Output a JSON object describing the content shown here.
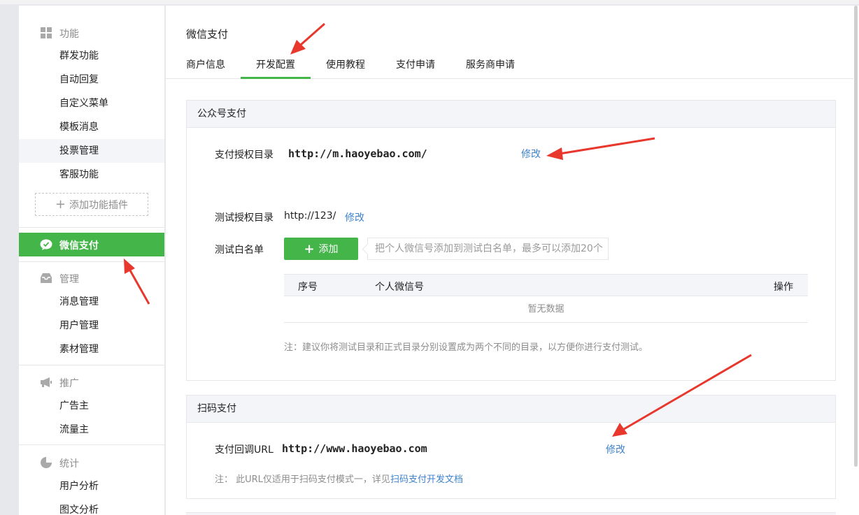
{
  "sidebar": {
    "sections": [
      {
        "heading": "功能",
        "icon": "grid-icon",
        "items": [
          "群发功能",
          "自动回复",
          "自定义菜单",
          "模板消息",
          "投票管理",
          "客服功能"
        ]
      },
      {
        "heading": "管理",
        "icon": "inbox-icon",
        "items": [
          "消息管理",
          "用户管理",
          "素材管理"
        ]
      },
      {
        "heading": "推广",
        "icon": "megaphone-icon",
        "items": [
          "广告主",
          "流量主"
        ]
      },
      {
        "heading": "统计",
        "icon": "pie-chart-icon",
        "items": [
          "用户分析",
          "图文分析"
        ]
      }
    ],
    "add_plugin": "添加功能插件",
    "active": {
      "label": "微信支付",
      "icon": "wechat-pay-icon"
    }
  },
  "main": {
    "title": "微信支付",
    "tabs": [
      "商户信息",
      "开发配置",
      "使用教程",
      "支付申请",
      "服务商申请"
    ],
    "active_tab": "开发配置",
    "official_pay": {
      "title": "公众号支付",
      "auth_dir_label": "支付授权目录",
      "auth_dir_value": "http://m.haoyebao.com/",
      "modify": "修改",
      "test_dir_label": "测试授权目录",
      "test_dir_value": "http://123/",
      "whitelist_label": "测试白名单",
      "add_button": "添加",
      "whitelist_hint": "把个人微信号添加到测试白名单，最多可以添加20个",
      "table_headers": [
        "序号",
        "个人微信号",
        "操作"
      ],
      "empty_text": "暂无数据",
      "note": "注：建议你将测试目录和正式目录分别设置成为两个不同的目录，以方便你进行支付测试。"
    },
    "scan_pay": {
      "title": "扫码支付",
      "callback_label": "支付回调URL",
      "callback_value": "http://www.haoyebao.com",
      "modify": "修改",
      "note_prefix": "注： 此URL仅适用于扫码支付模式一，详见",
      "note_link": "扫码支付开发文档"
    }
  },
  "colors": {
    "accent_green": "#44b549",
    "link_blue": "#3e83cb",
    "annotation_red": "#e8372d"
  }
}
